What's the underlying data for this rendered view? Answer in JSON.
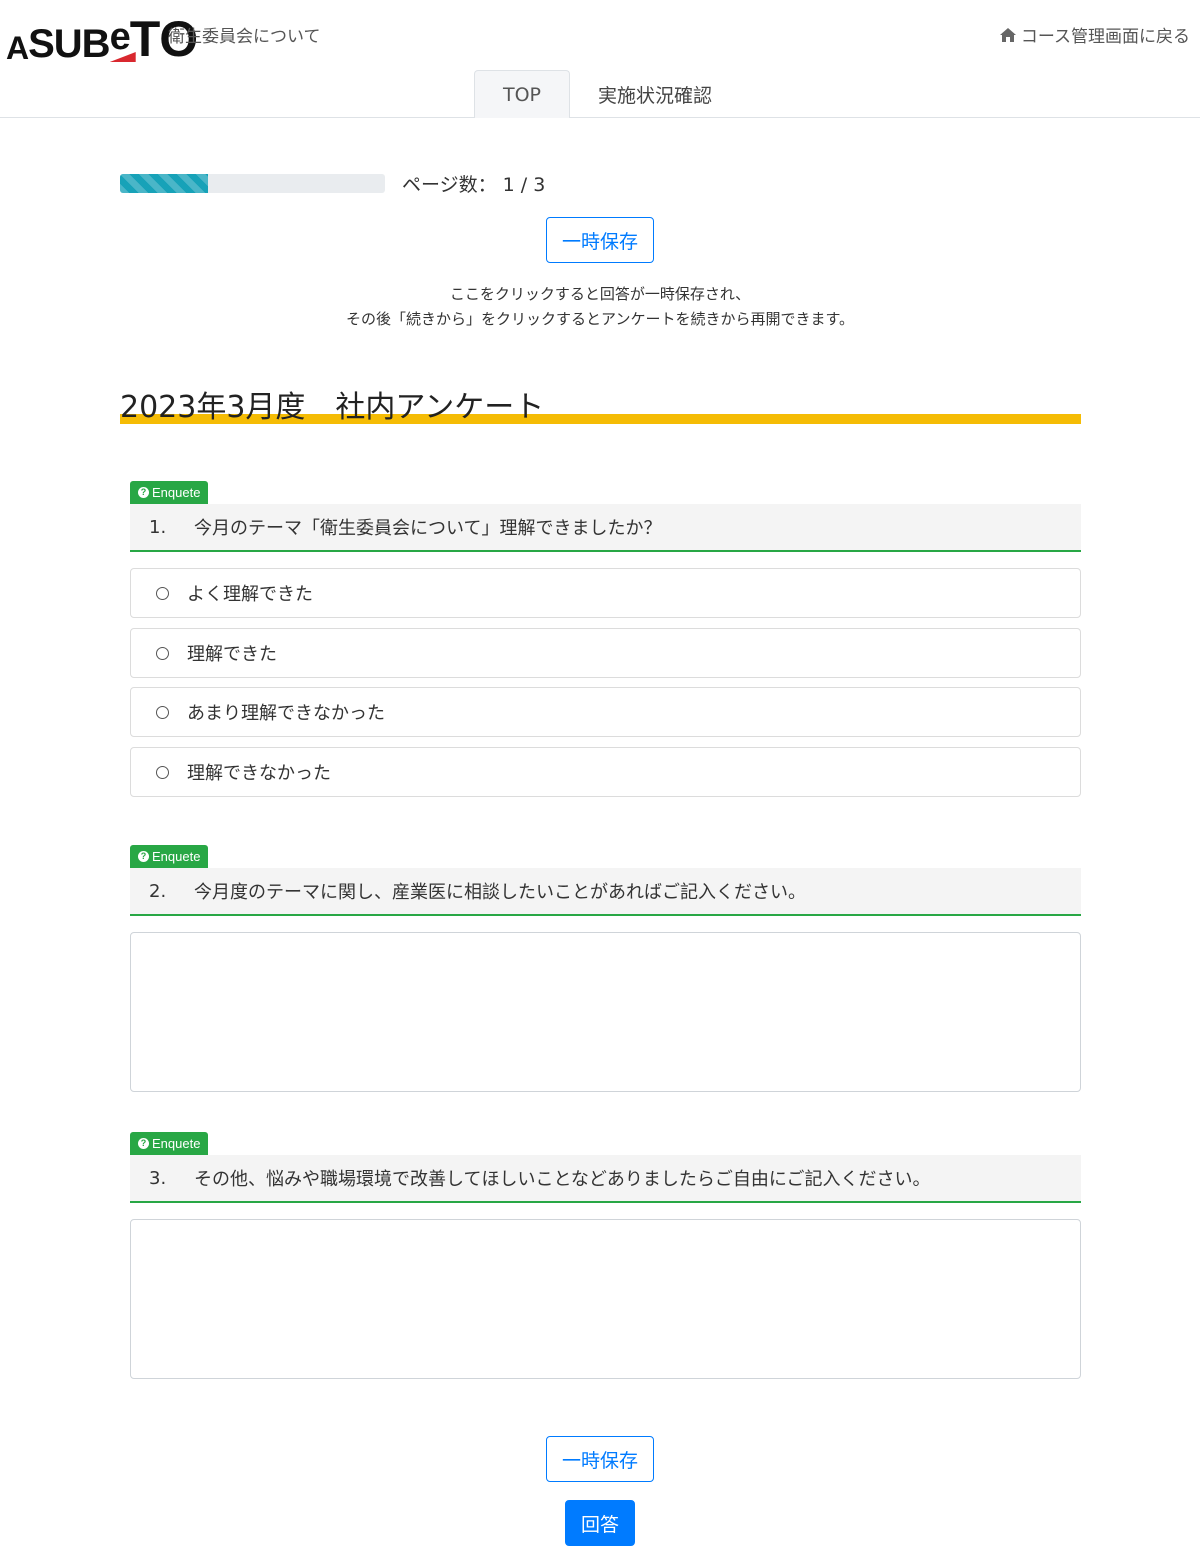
{
  "header": {
    "logo_parts": [
      "A",
      "SUB",
      "e",
      "T",
      "O"
    ],
    "course_title": "衛生委員会について",
    "back_label": "コース管理画面に戻る",
    "back_icon": "home-icon"
  },
  "tabs": [
    {
      "label": "TOP",
      "active": true
    },
    {
      "label": "実施状況確認",
      "active": false
    }
  ],
  "progress": {
    "fraction": 0.3333,
    "label": "ページ数： 1 / 3"
  },
  "save_button_label": "一時保存",
  "save_note": [
    "ここをクリックすると回答が一時保存され、",
    "その後「続きから」をクリックするとアンケートを続きから再開できます。"
  ],
  "survey_title": "2023年3月度　社内アンケート",
  "badge_label": "Enquete",
  "questions": [
    {
      "number": "1.",
      "text": "今月のテーマ「衛生委員会について」理解できましたか？",
      "options": [
        "よく理解できた",
        "理解できた",
        "あまり理解できなかった",
        "理解できなかった"
      ]
    },
    {
      "number": "2.",
      "text": "今月度のテーマに関し、産業医に相談したいことがあればご記入ください。",
      "answer": ""
    },
    {
      "number": "3.",
      "text": "その他、悩みや職場環境で改善してほしいことなどありましたらご自由にご記入ください。",
      "answer": ""
    }
  ],
  "submit_label": "回答",
  "colors": {
    "accent": "#007bff",
    "progress": "#17a2b8",
    "badge": "#28a745",
    "title_underline": "#f5bc05",
    "logo_red": "#d9282f"
  }
}
